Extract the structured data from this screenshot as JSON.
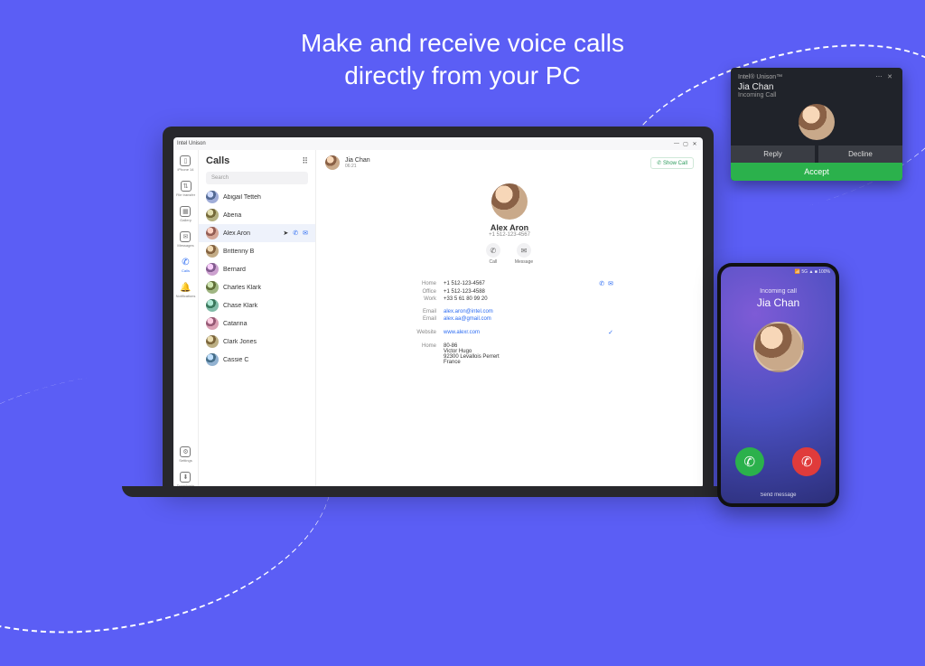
{
  "hero": {
    "line1": "Make and receive voice calls",
    "line2": "directly from your PC"
  },
  "window": {
    "title": "Intel Unison",
    "nav": [
      {
        "id": "phone",
        "label": "iPhone 14"
      },
      {
        "id": "file-transfer",
        "label": "File transfer"
      },
      {
        "id": "gallery",
        "label": "Gallery"
      },
      {
        "id": "messages",
        "label": "Messages"
      },
      {
        "id": "calls",
        "label": "Calls",
        "active": true
      },
      {
        "id": "notifications",
        "label": "Notifications"
      }
    ],
    "settings_label": "Settings",
    "downloads_label": "Downloads"
  },
  "calls": {
    "heading": "Calls",
    "search_placeholder": "Search",
    "contacts": [
      {
        "name": "Abigail Tetteh"
      },
      {
        "name": "Abena"
      },
      {
        "name": "Alex Aron",
        "selected": true
      },
      {
        "name": "Brittenny B"
      },
      {
        "name": "Bernard"
      },
      {
        "name": "Charles Klark"
      },
      {
        "name": "Chase Klark"
      },
      {
        "name": "Catarina"
      },
      {
        "name": "Clark Jones"
      },
      {
        "name": "Cassie C"
      }
    ]
  },
  "active_bar": {
    "name": "Jia Chan",
    "timer": "06:21",
    "show_call": "Show Call"
  },
  "contact_card": {
    "name": "Alex Aron",
    "primary_phone": "+1 512-123-4567",
    "actions": {
      "call": "Call",
      "message": "Message"
    },
    "phones": [
      {
        "label": "Home",
        "value": "+1 512-123-4567"
      },
      {
        "label": "Office",
        "value": "+1 512-123-4588"
      },
      {
        "label": "Work",
        "value": "+33 5 61 80 99 20"
      }
    ],
    "emails": [
      {
        "label": "Email",
        "value": "alex.aron@intel.com"
      },
      {
        "label": "Email",
        "value": "alex.aa@gmail.com"
      }
    ],
    "website": {
      "label": "Website",
      "value": "www.alexr.com"
    },
    "address": {
      "label": "Home",
      "lines": [
        "80-86",
        "Victor Hugo",
        "92300 Levallois Perrert",
        "France"
      ]
    }
  },
  "notification": {
    "app": "Intel® Unison™",
    "name": "Jia Chan",
    "sub": "Incoming Call",
    "reply": "Reply",
    "decline": "Decline",
    "accept": "Accept"
  },
  "phone": {
    "status": "📶 5G ▲ ■ 100%",
    "sub": "Incoming call",
    "name": "Jia Chan",
    "send_msg": "Send message"
  },
  "avatar_hues": [
    200,
    30,
    340,
    10,
    260,
    55,
    120,
    300,
    20,
    180
  ]
}
